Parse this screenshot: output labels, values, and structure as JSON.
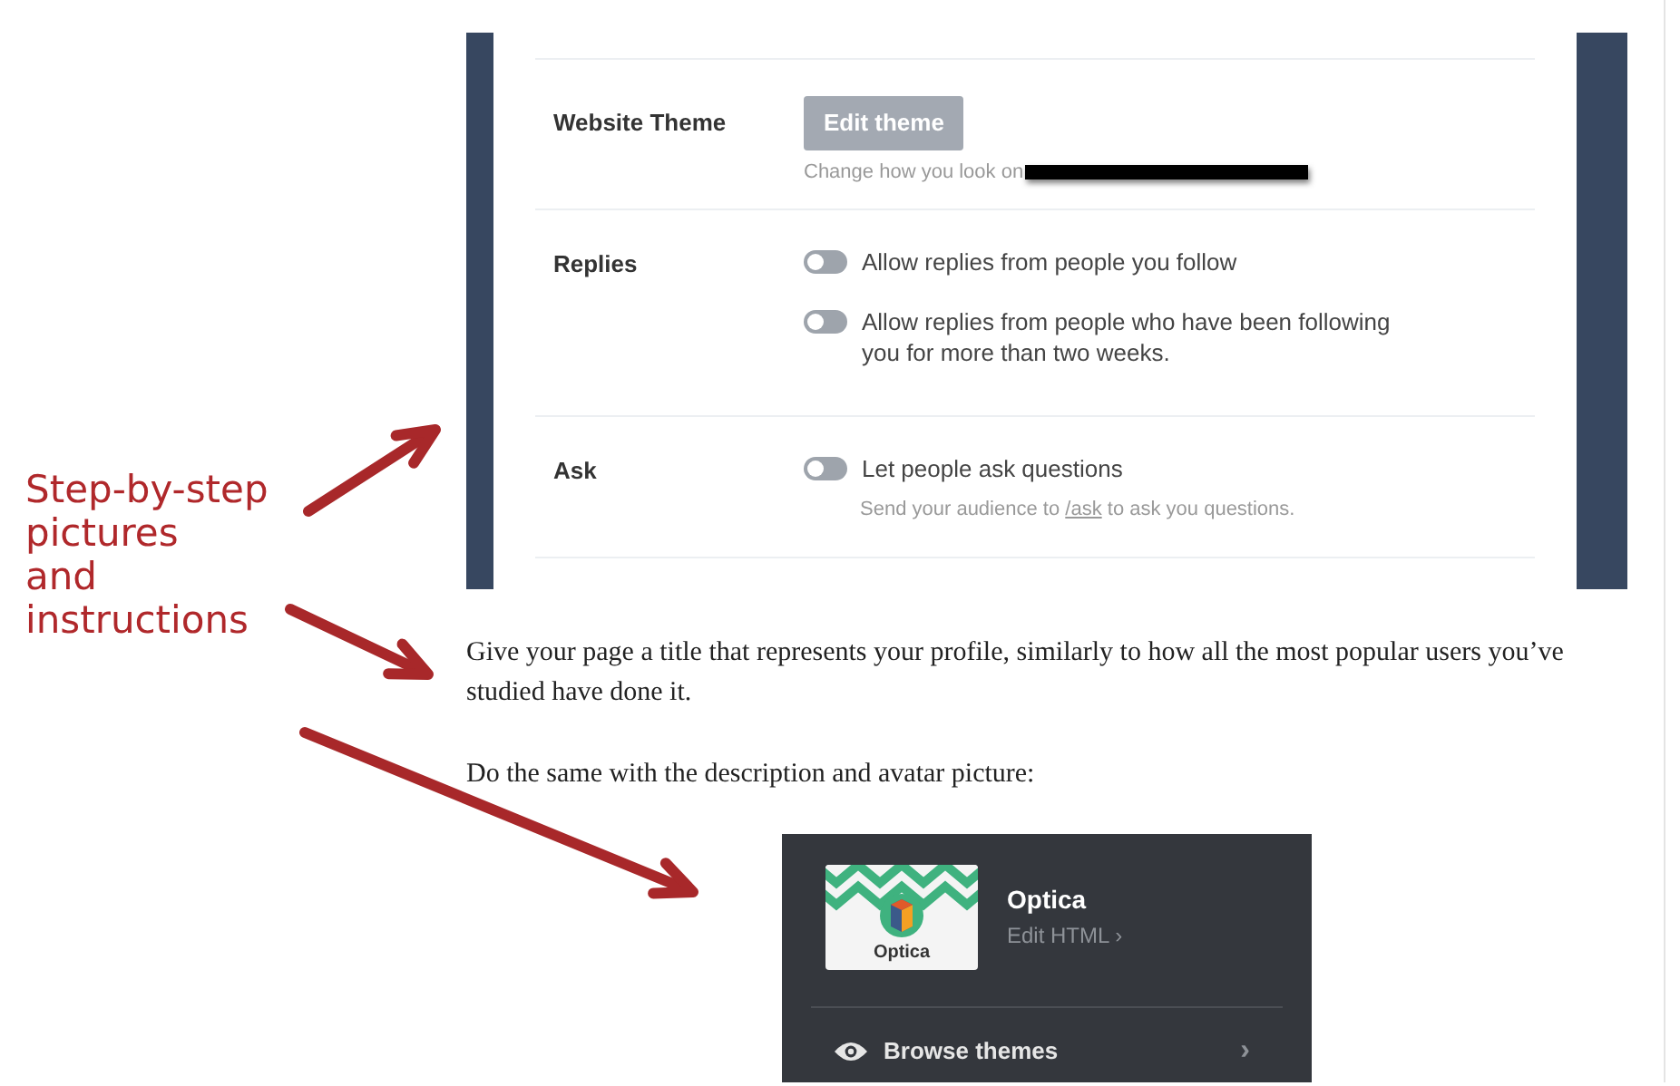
{
  "annotation": {
    "lines": [
      "Step-by-step",
      "pictures",
      "and",
      "instructions"
    ]
  },
  "settings_screenshot": {
    "rows": [
      {
        "label": "Website Theme",
        "kind": "button",
        "button": "Edit theme",
        "note": "Change how you look on",
        "redacted": true
      },
      {
        "label": "Replies",
        "kind": "toggles",
        "toggles": [
          {
            "text": "Allow replies from people you follow",
            "on": false
          },
          {
            "text": "Allow replies from people who have been following you for more than two weeks.",
            "on": false
          }
        ]
      },
      {
        "label": "Ask",
        "kind": "toggles",
        "toggles": [
          {
            "text": "Let people ask questions",
            "on": false
          }
        ],
        "note_parts": [
          "Send your audience to ",
          "/ask",
          " to ask you questions."
        ]
      }
    ]
  },
  "paragraphs": [
    "Give your page a title that represents your profile, similarly to how all the most popular users you’ve studied have done it.",
    "Do the same with the description and avatar picture:"
  ],
  "theme_panel": {
    "thumbnail_label": "Optica",
    "title": "Optica",
    "edit_link": "Edit HTML ›",
    "browse": "Browse themes",
    "browse_chevron": "›"
  }
}
